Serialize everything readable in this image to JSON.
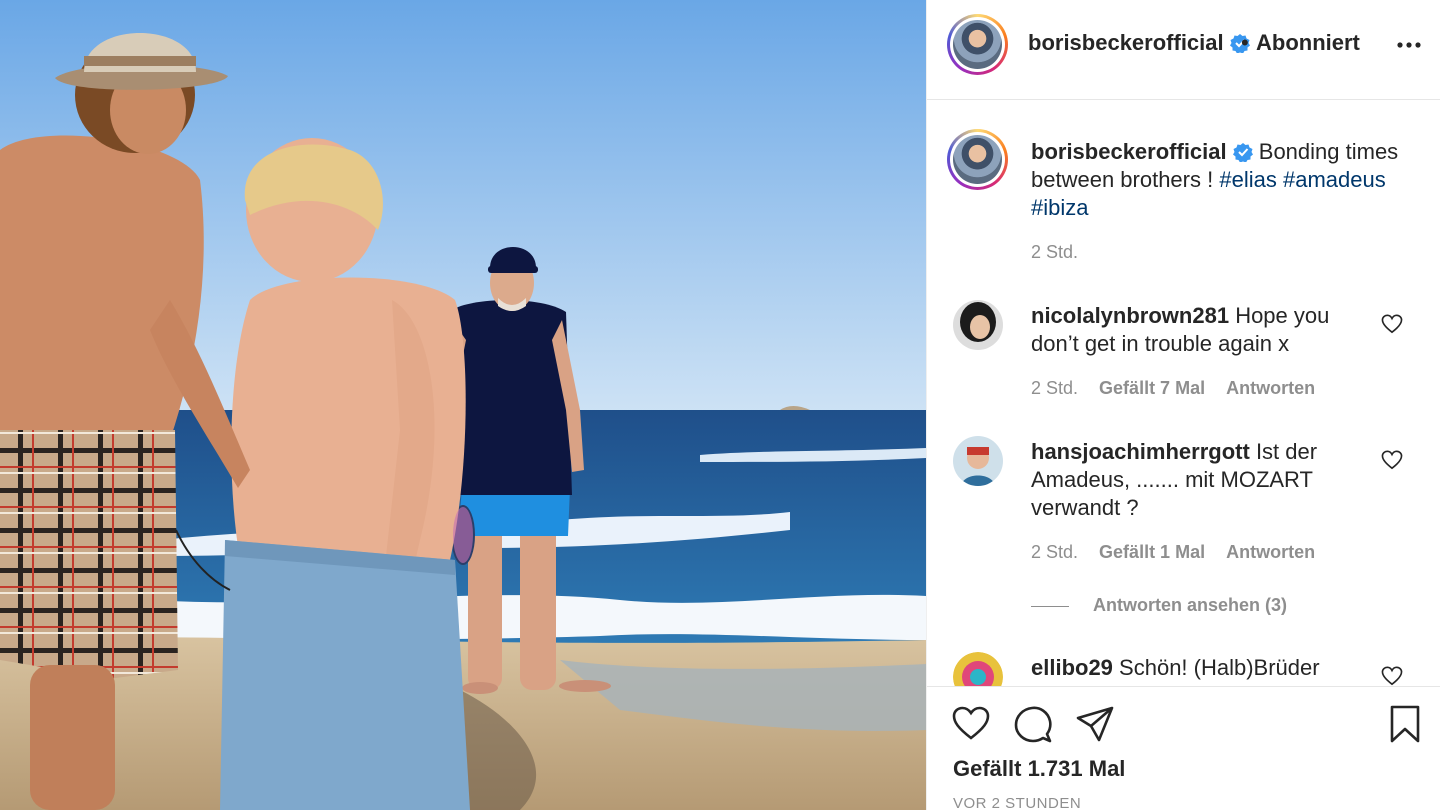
{
  "header": {
    "username": "borisbeckerofficial",
    "separator": "•",
    "follow_status": "Abonniert"
  },
  "caption": {
    "username": "borisbeckerofficial",
    "text": "Bonding times between brothers !",
    "hashtags": [
      "#elias",
      "#amadeus",
      "#ibiza"
    ],
    "time": "2 Std."
  },
  "comments": [
    {
      "username": "nicolalynbrown281",
      "text": "Hope you don’t get in trouble again x",
      "time": "2 Std.",
      "likes": "Gefällt 7 Mal",
      "reply": "Antworten"
    },
    {
      "username": "hansjoachimherrgott",
      "text": "Ist der Amadeus, ....... mit MOZART verwandt ?",
      "time": "2 Std.",
      "likes": "Gefällt 1 Mal",
      "reply": "Antworten",
      "view_replies": "Antworten ansehen (3)"
    },
    {
      "username": "ellibo29",
      "text": "Schön! (Halb)Brüder"
    }
  ],
  "footer": {
    "likes": "Gefällt 1.731 Mal",
    "date": "VOR 2 STUNDEN"
  },
  "icons": [
    "verified-badge-icon",
    "more-options-icon",
    "heart-icon",
    "comment-icon",
    "share-icon",
    "bookmark-icon"
  ],
  "colors": {
    "verified": "#3897f0",
    "hashtag": "#00376b",
    "muted": "#8e8e8e"
  }
}
